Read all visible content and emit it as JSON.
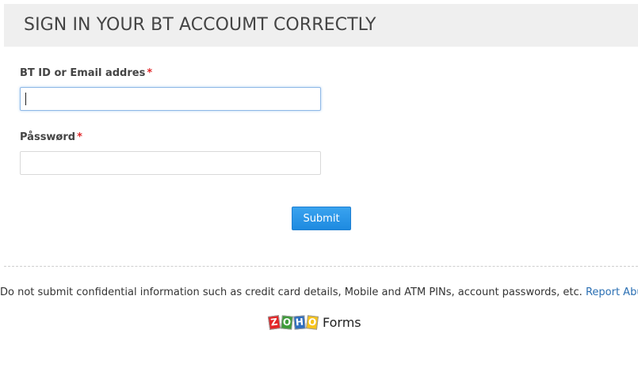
{
  "header": {
    "title": "SIGN IN YOUR BT ACCOUMT CORRECTLY"
  },
  "form": {
    "email_label": "BT ID or Email addres",
    "email_required": "*",
    "email_value": "",
    "password_label": "Påsswørd",
    "password_required": "*",
    "password_value": "",
    "submit_label": "Submit"
  },
  "footer": {
    "notice": "Do not submit confidential information such as credit card details, Mobile and ATM PINs, account passwords, etc.",
    "report_link": "Report Abuse",
    "brand_letters": [
      "Z",
      "O",
      "H",
      "O"
    ],
    "brand_word": "Forms",
    "brand_colors": [
      "#e42527",
      "#3e9b3a",
      "#2d6dbf",
      "#f7c31a"
    ]
  },
  "colors": {
    "header_bg": "#efefef",
    "required": "#e0292b",
    "button": "#1e8ae0",
    "link": "#2a6fb3"
  }
}
